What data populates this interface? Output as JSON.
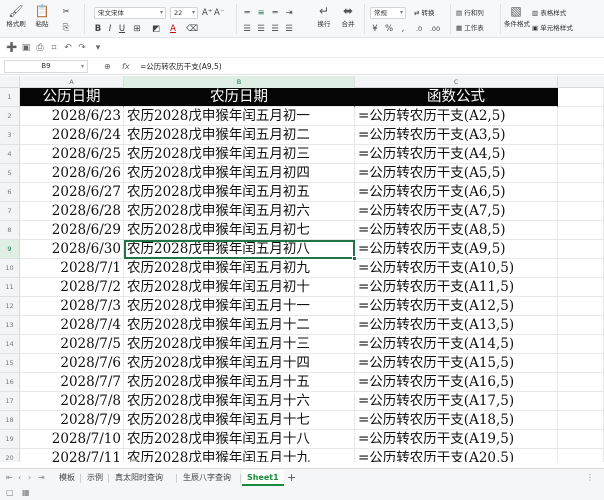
{
  "ribbon": {
    "format_painter": "格式刷",
    "paste": "粘贴",
    "cut_icon": "scissors-icon",
    "font_name": "宋文宋体",
    "font_size": "22",
    "wrap_label": "换行",
    "merge_label": "合并",
    "number_format": "常规",
    "convert_label": "转换",
    "row_col_label": "行和列",
    "worksheet_label": "工作表",
    "cond_format_label": "条件格式",
    "table_style_label": "表格样式",
    "cell_style_label": "单元格样式",
    "sum_label": "求和",
    "bold": "B",
    "italic": "I",
    "underline": "U",
    "font_color": "A"
  },
  "formula_bar": {
    "cell_ref": "B9",
    "fx": "fx",
    "formula": "=公历转农历干支(A9,5)"
  },
  "columns": [
    {
      "id": "A",
      "label": "A"
    },
    {
      "id": "B",
      "label": "B"
    },
    {
      "id": "C",
      "label": "C"
    }
  ],
  "selected_column": "B",
  "selected_row": "9",
  "header_row": {
    "row_number": "1",
    "a": "公历日期",
    "b": "农历日期",
    "c": "函数公式"
  },
  "rows": [
    {
      "row_number": "2",
      "a": "2028/6/23",
      "b": "农历2028戊申猴年闰五月初一",
      "c": "=公历转农历干支(A2,5)"
    },
    {
      "row_number": "3",
      "a": "2028/6/24",
      "b": "农历2028戊申猴年闰五月初二",
      "c": "=公历转农历干支(A3,5)"
    },
    {
      "row_number": "4",
      "a": "2028/6/25",
      "b": "农历2028戊申猴年闰五月初三",
      "c": "=公历转农历干支(A4,5)"
    },
    {
      "row_number": "5",
      "a": "2028/6/26",
      "b": "农历2028戊申猴年闰五月初四",
      "c": "=公历转农历干支(A5,5)"
    },
    {
      "row_number": "6",
      "a": "2028/6/27",
      "b": "农历2028戊申猴年闰五月初五",
      "c": "=公历转农历干支(A6,5)"
    },
    {
      "row_number": "7",
      "a": "2028/6/28",
      "b": "农历2028戊申猴年闰五月初六",
      "c": "=公历转农历干支(A7,5)"
    },
    {
      "row_number": "8",
      "a": "2028/6/29",
      "b": "农历2028戊申猴年闰五月初七",
      "c": "=公历转农历干支(A8,5)"
    },
    {
      "row_number": "9",
      "a": "2028/6/30",
      "b": "农历2028戊申猴年闰五月初八",
      "c": "=公历转农历干支(A9,5)"
    },
    {
      "row_number": "10",
      "a": "2028/7/1",
      "b": "农历2028戊申猴年闰五月初九",
      "c": "=公历转农历干支(A10,5)"
    },
    {
      "row_number": "11",
      "a": "2028/7/2",
      "b": "农历2028戊申猴年闰五月初十",
      "c": "=公历转农历干支(A11,5)"
    },
    {
      "row_number": "12",
      "a": "2028/7/3",
      "b": "农历2028戊申猴年闰五月十一",
      "c": "=公历转农历干支(A12,5)"
    },
    {
      "row_number": "13",
      "a": "2028/7/4",
      "b": "农历2028戊申猴年闰五月十二",
      "c": "=公历转农历干支(A13,5)"
    },
    {
      "row_number": "14",
      "a": "2028/7/5",
      "b": "农历2028戊申猴年闰五月十三",
      "c": "=公历转农历干支(A14,5)"
    },
    {
      "row_number": "15",
      "a": "2028/7/6",
      "b": "农历2028戊申猴年闰五月十四",
      "c": "=公历转农历干支(A15,5)"
    },
    {
      "row_number": "16",
      "a": "2028/7/7",
      "b": "农历2028戊申猴年闰五月十五",
      "c": "=公历转农历干支(A16,5)"
    },
    {
      "row_number": "17",
      "a": "2028/7/8",
      "b": "农历2028戊申猴年闰五月十六",
      "c": "=公历转农历干支(A17,5)"
    },
    {
      "row_number": "18",
      "a": "2028/7/9",
      "b": "农历2028戊申猴年闰五月十七",
      "c": "=公历转农历干支(A18,5)"
    },
    {
      "row_number": "19",
      "a": "2028/7/10",
      "b": "农历2028戊申猴年闰五月十八",
      "c": "=公历转农历干支(A19,5)"
    },
    {
      "row_number": "20",
      "a": "2028/7/11",
      "b": "农历2028戊申猴年闰五月十九",
      "c": "=公历转农历干支(A20,5)"
    },
    {
      "row_number": "21",
      "a": "",
      "b": "",
      "c": ""
    }
  ],
  "sheet_tabs": [
    {
      "label": "模板",
      "active": false
    },
    {
      "label": "示例",
      "active": false
    },
    {
      "label": "真太阳时查询",
      "active": false
    },
    {
      "label": "生辰八字查询",
      "active": false
    },
    {
      "label": "Sheet1",
      "active": true
    }
  ],
  "add_sheet": "+",
  "colors": {
    "accent": "#217346",
    "active_tab": "#1a8b3c",
    "header_fill": "#050505",
    "header_text": "#ffffff"
  }
}
